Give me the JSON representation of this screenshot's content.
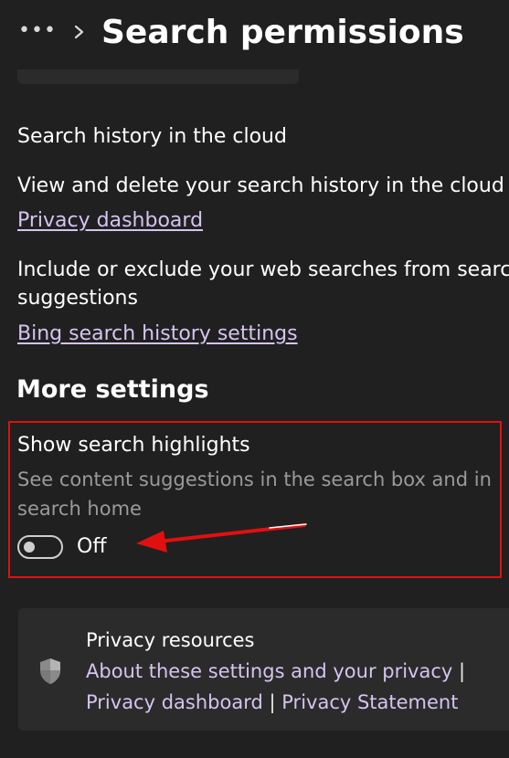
{
  "header": {
    "more_label": "•••",
    "title": "Search permissions"
  },
  "search_history": {
    "heading": "Search history in the cloud",
    "view_delete_text": "View and delete your search history in the cloud",
    "privacy_dashboard_link": "Privacy dashboard",
    "include_exclude_line1": "Include or exclude your web searches from search",
    "include_exclude_line2": "suggestions",
    "bing_settings_link": "Bing search history settings"
  },
  "more_settings": {
    "title": "More settings",
    "highlights": {
      "label": "Show search highlights",
      "description_line1": "See content suggestions in the search box and in",
      "description_line2": "search home",
      "toggle_state": "Off",
      "toggle_on": false
    }
  },
  "privacy_resources": {
    "title": "Privacy resources",
    "about_link": "About these settings and your privacy",
    "dashboard_link": "Privacy dashboard",
    "statement_link": "Privacy Statement",
    "separator": "|"
  },
  "colors": {
    "background": "#202020",
    "card": "#2b2b2b",
    "link": "#d6c3f0",
    "annotation_red": "#e01010"
  },
  "icons": {
    "more": "more-dots-icon",
    "chevron": "chevron-right-icon",
    "shield": "shield-icon",
    "arrow": "annotation-arrow-icon"
  }
}
